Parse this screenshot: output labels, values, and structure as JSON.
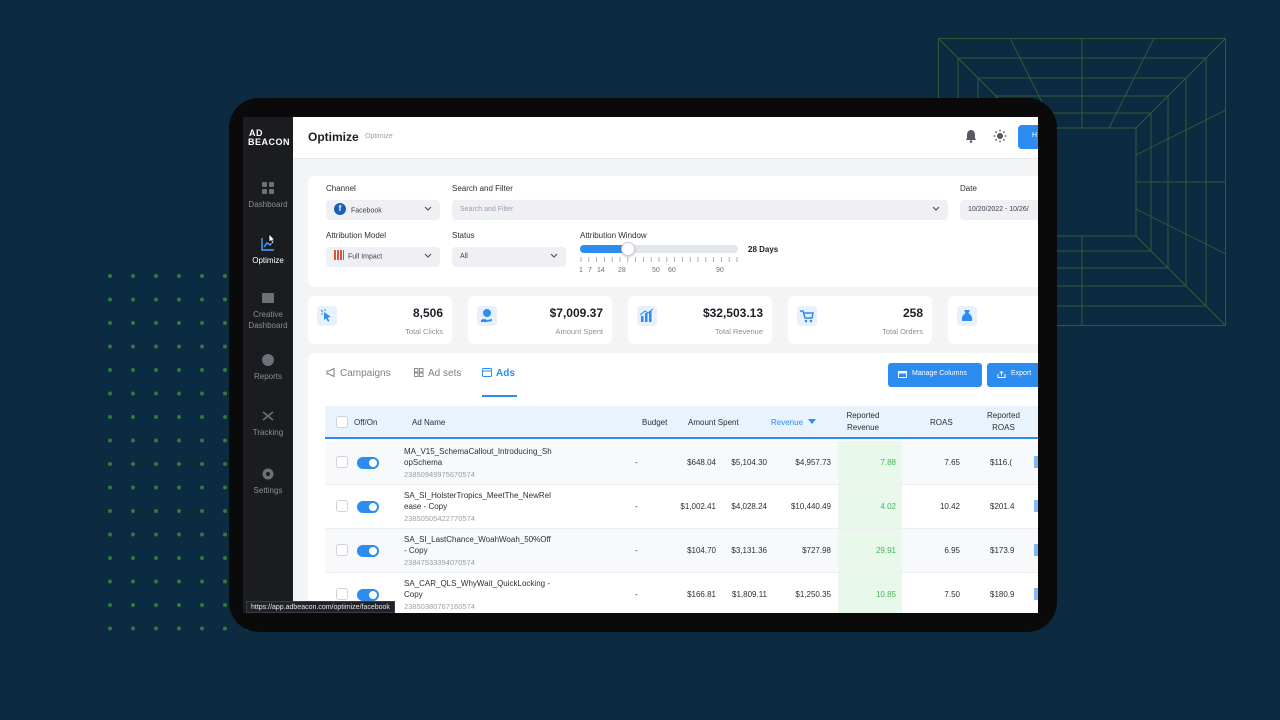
{
  "sidebar": {
    "logo_line1": "AD",
    "logo_line2": "BEACON",
    "items": [
      {
        "label": "Dashboard",
        "icon": "grid-icon"
      },
      {
        "label": "Optimize",
        "icon": "chart-trend-icon",
        "active": true
      },
      {
        "label": "Creative Dashboard",
        "icon": "image-icon"
      },
      {
        "label": "Reports",
        "icon": "pie-icon"
      },
      {
        "label": "Tracking",
        "icon": "tracking-icon"
      },
      {
        "label": "Settings",
        "icon": "gear-icon"
      }
    ]
  },
  "header": {
    "title": "Optimize",
    "crumb": "Optimize",
    "button_label": "H"
  },
  "filters": {
    "channel_label": "Channel",
    "channel_value": "Facebook",
    "search_label": "Search and Filter",
    "search_placeholder": "Search and Filter",
    "date_label": "Date",
    "date_value": "10/20/2022 - 10/26/",
    "attribution_model_label": "Attribution Model",
    "attribution_model_value": "Full Impact",
    "status_label": "Status",
    "status_value": "All",
    "attribution_window_label": "Attribution Window",
    "attribution_window_value": "28 Days",
    "attribution_window_fraction": 0.3,
    "ticks": [
      "1",
      "7",
      "14",
      "28",
      "50",
      "60",
      "90"
    ]
  },
  "stats": [
    {
      "value": "8,506",
      "label": "Total Clicks",
      "icon": "cursor-click-icon"
    },
    {
      "value": "$7,009.37",
      "label": "Amount Spent",
      "icon": "hand-coin-icon"
    },
    {
      "value": "$32,503.13",
      "label": "Total Revenue",
      "icon": "bar-chart-icon"
    },
    {
      "value": "258",
      "label": "Total Orders",
      "icon": "cart-icon"
    },
    {
      "value": "",
      "label": "",
      "icon": "money-bag-icon"
    }
  ],
  "tabs": [
    {
      "label": "Campaigns",
      "icon": "megaphone-icon"
    },
    {
      "label": "Ad sets",
      "icon": "grid-small-icon"
    },
    {
      "label": "Ads",
      "icon": "ad-icon",
      "active": true
    }
  ],
  "actions": {
    "manage_columns": "Manage Columns",
    "export": "Export"
  },
  "table": {
    "headers": {
      "offon": "Off/On",
      "ad_name": "Ad Name",
      "budget": "Budget",
      "amount_spent": "Amount Spent",
      "revenue": "Revenue",
      "reported_revenue_1": "Reported",
      "reported_revenue_2": "Revenue",
      "roas": "ROAS",
      "reported_roas_1": "Reported",
      "reported_roas_2": "ROAS"
    },
    "rows": [
      {
        "name": "MA_V15_SchemaCallout_Introducing_ShopSchema",
        "name1": "MA_V15_SchemaCallout_Introducing_Sh",
        "name2": "opSchema",
        "id": "23850949975670574",
        "budget": "-",
        "spent": "$648.04",
        "amount_spent": "$5,104.30",
        "revenue": "$4,957.73",
        "reported": "7.88",
        "roas": "7.65",
        "reported_roas": "$116.("
      },
      {
        "name": "SA_SI_HolsterTropics_MeetThe_NewRelease - Copy",
        "name1": "SA_SI_HolsterTropics_MeetThe_NewRel",
        "name2": "ease - Copy",
        "id": "23850505422770574",
        "budget": "-",
        "spent": "$1,002.41",
        "amount_spent": "$4,028.24",
        "revenue": "$10,440.49",
        "reported": "4.02",
        "roas": "10.42",
        "reported_roas": "$201.4"
      },
      {
        "name": "SA_SI_LastChance_WoahWoah_50%Off - Copy",
        "name1": "SA_SI_LastChance_WoahWoah_50%Off",
        "name2": "- Copy",
        "id": "23847533394070574",
        "budget": "-",
        "spent": "$104.70",
        "amount_spent": "$3,131.36",
        "revenue": "$727.98",
        "reported": "29.91",
        "roas": "6.95",
        "reported_roas": "$173.9"
      },
      {
        "name": "SA_CAR_QLS_WhyWait_QuickLocking - Copy",
        "name1": "SA_CAR_QLS_WhyWait_QuickLocking -",
        "name2": "Copy",
        "id": "23850380767160574",
        "budget": "-",
        "spent": "$166.81",
        "amount_spent": "$1,809.11",
        "revenue": "$1,250.35",
        "reported": "10.85",
        "roas": "7.50",
        "reported_roas": "$180.9"
      }
    ]
  },
  "status_url": "https://app.adbeacon.com/optimize/facebook",
  "colors": {
    "background": "#0c2a40",
    "accent": "#2d8cf0",
    "sidebar": "#1a1c20",
    "positive": "#43b65a"
  }
}
